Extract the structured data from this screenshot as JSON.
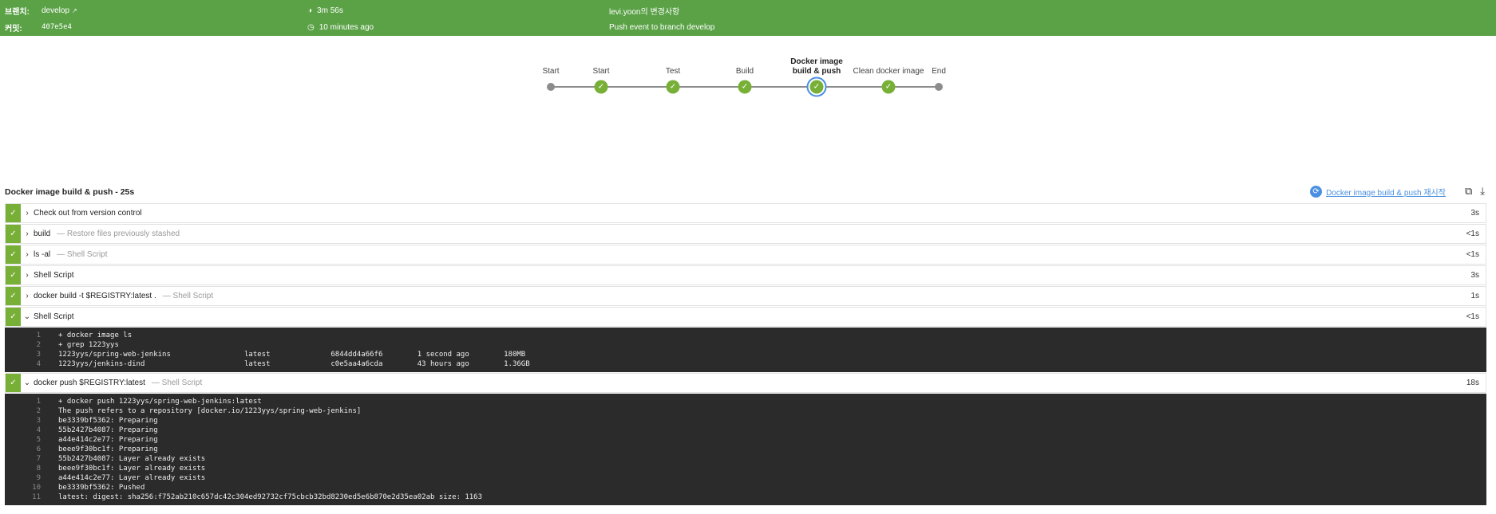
{
  "header": {
    "branch_label": "브랜치:",
    "branch_value": "develop",
    "commit_label": "커밋:",
    "commit_value": "407e5e4",
    "duration": "3m 56s",
    "time_ago": "10 minutes ago",
    "changes": "levi.yoon의 변경사항",
    "cause": "Push event to branch develop"
  },
  "pipeline": {
    "stages": [
      {
        "label": "Start",
        "status": "start"
      },
      {
        "label": "Start",
        "status": "success"
      },
      {
        "label": "Test",
        "status": "success"
      },
      {
        "label": "Build",
        "status": "success"
      },
      {
        "label": "Docker image build & push",
        "status": "success-selected"
      },
      {
        "label": "Clean docker image",
        "status": "success"
      },
      {
        "label": "End",
        "status": "end"
      }
    ]
  },
  "detail": {
    "title": "Docker image build & push - 25s",
    "restart_label": "Docker image build & push 재시작",
    "steps": [
      {
        "name": "Check out from version control",
        "desc": "",
        "duration": "3s"
      },
      {
        "name": "build",
        "desc": "— Restore files previously stashed",
        "duration": "<1s"
      },
      {
        "name": "ls -al",
        "desc": "— Shell Script",
        "duration": "<1s"
      },
      {
        "name": "Shell Script",
        "desc": "",
        "duration": "3s"
      },
      {
        "name": "docker build -t $REGISTRY:latest .",
        "desc": "— Shell Script",
        "duration": "1s"
      },
      {
        "name": "Shell Script",
        "desc": "",
        "duration": "<1s"
      },
      {
        "name": "docker push $REGISTRY:latest",
        "desc": "— Shell Script",
        "duration": "18s"
      }
    ],
    "log1": [
      "+ docker image ls",
      "+ grep 1223yys",
      "1223yys/spring-web-jenkins                 latest              6844dd4a66f6        1 second ago        180MB",
      "1223yys/jenkins-dind                       latest              c0e5aa4a6cda        43 hours ago        1.36GB"
    ],
    "log2": [
      "+ docker push 1223yys/spring-web-jenkins:latest",
      "The push refers to a repository [docker.io/1223yys/spring-web-jenkins]",
      "be3339bf5362: Preparing",
      "55b2427b4087: Preparing",
      "a44e414c2e77: Preparing",
      "beee9f30bc1f: Preparing",
      "55b2427b4087: Layer already exists",
      "beee9f30bc1f: Layer already exists",
      "a44e414c2e77: Layer already exists",
      "be3339bf5362: Pushed",
      "latest: digest: sha256:f752ab210c657dc42c304ed92732cf75cbcb32bd8230ed5e6b870e2d35ea02ab size: 1163"
    ]
  },
  "colors": {
    "header_bg": "#5ba247",
    "success": "#78b037",
    "selected_ring": "#4a90e2",
    "log_bg": "#2b2b2b"
  }
}
